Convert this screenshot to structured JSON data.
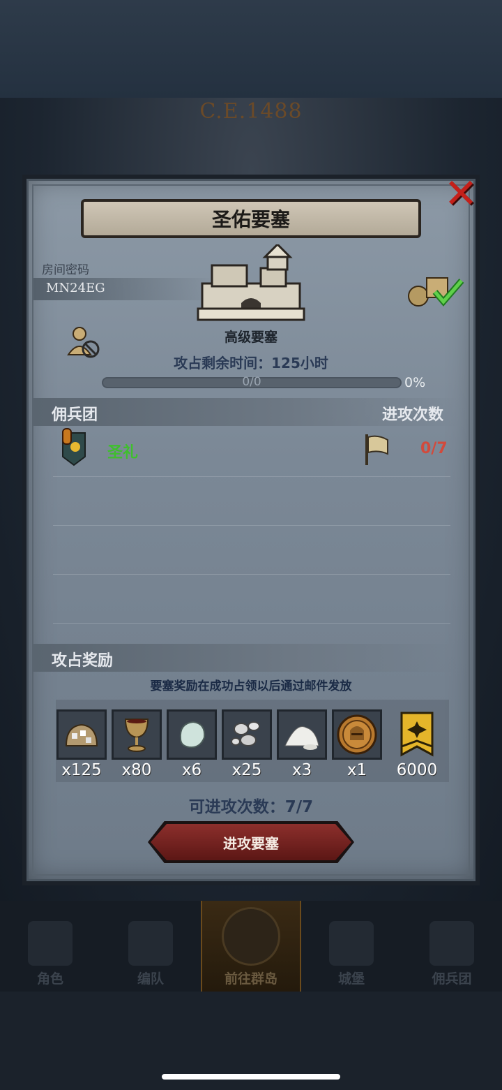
{
  "era": "C.E.1488",
  "dialog": {
    "title": "圣佑要塞",
    "room_label": "房间密码",
    "room_code": "MN24EG",
    "fortress_level": "高级要塞",
    "time_label": "攻占剩余时间：",
    "time_value": "125小时",
    "progress_text": "0/0",
    "progress_pct": "0%",
    "progress_fraction": 0
  },
  "mercenary_section": {
    "title": "佣兵团",
    "attacks_header": "进攻次数",
    "rows": [
      {
        "name": "圣礼",
        "attacks": "0/7"
      }
    ]
  },
  "reward_section": {
    "title": "攻占奖励",
    "note": "要塞奖励在成功占领以后通过邮件发放",
    "items": [
      {
        "icon": "silver-ore-sack-icon",
        "count": "x125"
      },
      {
        "icon": "goblet-icon",
        "count": "x80"
      },
      {
        "icon": "moonstone-icon",
        "count": "x6"
      },
      {
        "icon": "silver-nuggets-icon",
        "count": "x25"
      },
      {
        "icon": "salt-pile-icon",
        "count": "x3"
      },
      {
        "icon": "knight-helmet-medal-icon",
        "count": "x1"
      },
      {
        "icon": "gold-banner-icon",
        "count": "6000"
      }
    ],
    "attackable_label": "可进攻次数：",
    "attackable_value": "7/7",
    "attack_button": "进攻要塞"
  },
  "bottom_nav": [
    {
      "label": "角色",
      "active": false
    },
    {
      "label": "编队",
      "active": false
    },
    {
      "label": "前往群岛",
      "active": true
    },
    {
      "label": "城堡",
      "active": false
    },
    {
      "label": "佣兵团",
      "active": false
    }
  ],
  "colors": {
    "merc_name": "#3fbf2d",
    "attack_count": "#d24a3c",
    "close": "#c4201a",
    "button": "#8c2f2c"
  }
}
